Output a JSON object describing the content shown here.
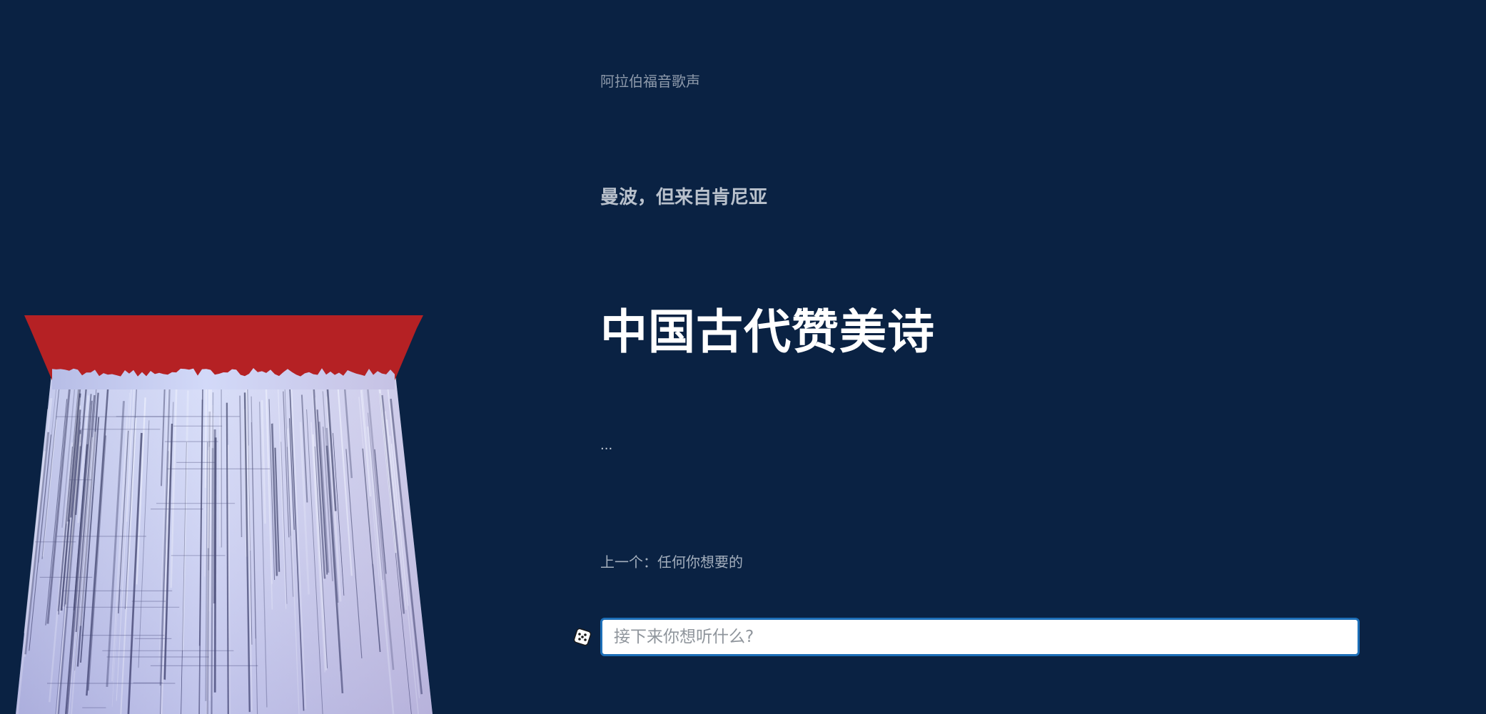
{
  "header": {
    "subtitle": "阿拉伯福音歌声",
    "station": "曼波，但来自肯尼亚"
  },
  "main": {
    "title": "中国古代赞美诗",
    "status": "...",
    "previous": "上一个：任何你想要的"
  },
  "prompt": {
    "value": "",
    "placeholder": "接下来你想听什么?"
  },
  "icons": {
    "random": "dice-icon"
  },
  "colors": {
    "background": "#0a2243",
    "visual_top": "#b52124",
    "visual_bars": "#c4cdf4",
    "input_border": "#1d6fb8"
  }
}
